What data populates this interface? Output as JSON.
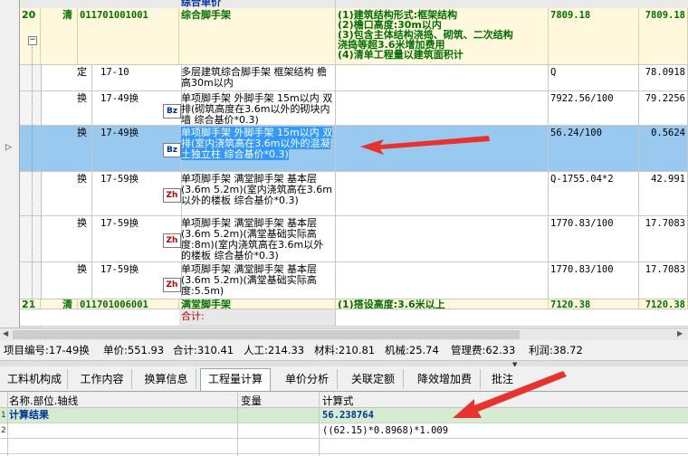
{
  "grid": {
    "header_partial": "综合单价",
    "qing_row_20": {
      "seq": "20",
      "type": "清",
      "code": "011701001001",
      "name": "综合脚手架",
      "features": [
        "(1)建筑结构形式:框架结构",
        "(2)檐口高度:30m以内",
        "(3)包含主体结构浇捣、砌筑、二次结构",
        "浇捣等超3.6米增加费用",
        "(4)清单工程量以建筑面积计"
      ],
      "expr": "7809.18",
      "qty": "7809.18"
    },
    "rows": [
      {
        "type": "定",
        "num": "17-10",
        "icon": "",
        "name": "多层建筑综合脚手架 框架结构 檐高30m以内",
        "expr": "Q",
        "qty": "78.0918"
      },
      {
        "type": "换",
        "num": "17-49换",
        "icon": "Bz",
        "name": "单项脚手架 外脚手架 15m以内 双排(砌筑高度在3.6m以外的砌块内墙 综合基价*0.3)",
        "expr": "7922.56/100",
        "qty": "79.2256"
      },
      {
        "type": "换",
        "num": "17-49换",
        "icon": "Bz",
        "name": "单项脚手架 外脚手架 15m以内 双排(室内浇筑高在3.6m以外的混凝土独立柱 综合基价*0.3)",
        "expr": "56.24/100",
        "qty": "0.5624"
      },
      {
        "type": "换",
        "num": "17-59换",
        "icon": "Zh",
        "name": "单项脚手架 满堂脚手架 基本层(3.6m 5.2m)(室内浇筑高在3.6m以外的楼板 综合基价*0.3)",
        "expr": "Q-1755.04*2",
        "qty": "42.991"
      },
      {
        "type": "换",
        "num": "17-59换",
        "icon": "Zh",
        "name": "单项脚手架 满堂脚手架 基本层(3.6m 5.2m)(满堂基础实际高度:8m)(室内浇筑高在3.6m以外的楼板 综合基价*0.3)",
        "expr": "1770.83/100",
        "qty": "17.7083"
      },
      {
        "type": "换",
        "num": "17-59换",
        "icon": "Zh",
        "name": "单项脚手架 满堂脚手架 基本层(3.6m 5.2m)(满堂基础实际高度:5.5m)",
        "expr": "1770.83/100",
        "qty": "17.7083"
      }
    ],
    "qing_row_21": {
      "seq": "21",
      "type": "清",
      "code": "011701006001",
      "name": "满堂脚手架",
      "features": "(1)搭设高度:3.6米以上",
      "expr": "7120.38",
      "qty": "7120.38"
    },
    "total_label": "合计:"
  },
  "status": {
    "item_code": "项目编号:17-49换",
    "unit_price": "单价:551.93",
    "total": "合计:310.41",
    "labor": "人工:214.33",
    "material": "材料:210.81",
    "machine": "机械:25.74",
    "management": "管理费:62.33",
    "profit": "利润:38.72"
  },
  "tabs": [
    "工料机构成",
    "工作内容",
    "换算信息",
    "工程量计算",
    "单价分析",
    "关联定额",
    "降效增加费",
    "批注"
  ],
  "active_tab": "工程量计算",
  "calc": {
    "headers": {
      "name": "名称.部位.轴线",
      "var": "变量",
      "formula": "计算式"
    },
    "rows": [
      {
        "idx": "1",
        "name": "计算结果",
        "var": "",
        "formula": "56.238764"
      },
      {
        "idx": "2",
        "name": "",
        "var": "",
        "formula": "((62.15)*0.8968)*1.009"
      }
    ]
  },
  "colors": {
    "arrow": "#e8322e",
    "qing_text": "#007000",
    "selected_row": "#99c9ef"
  }
}
